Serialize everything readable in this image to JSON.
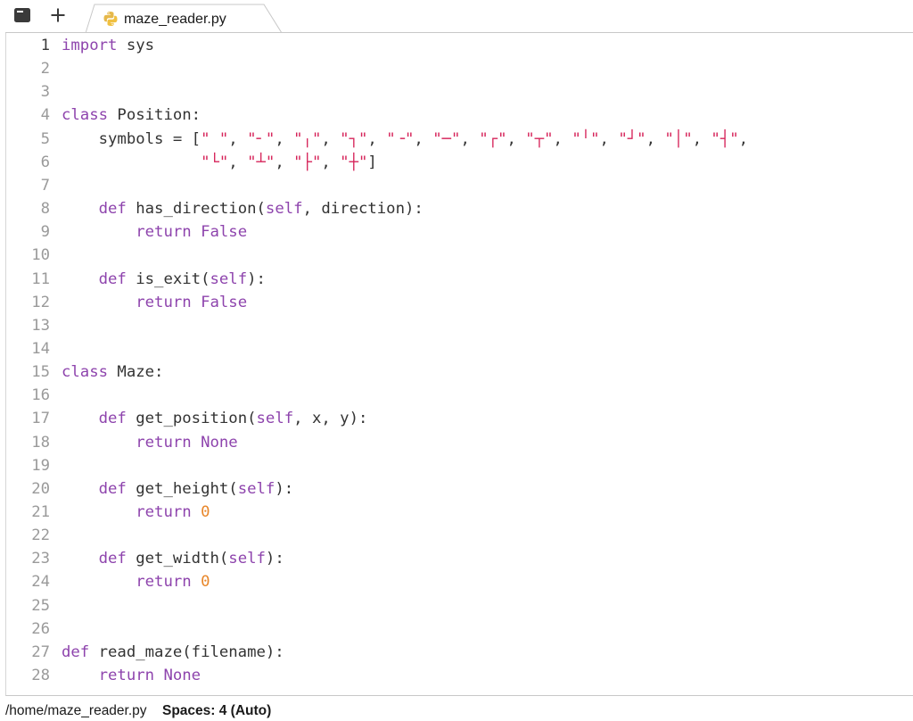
{
  "tabbar": {
    "menu_icon": "menu-square-icon",
    "add_icon": "plus-icon",
    "active_tab": {
      "label": "maze_reader.py",
      "icon": "python-icon"
    }
  },
  "editor": {
    "active_line": 1,
    "lines": [
      {
        "n": "1",
        "tokens": [
          [
            "kw",
            "import"
          ],
          [
            "p",
            " sys"
          ]
        ]
      },
      {
        "n": "2",
        "tokens": []
      },
      {
        "n": "3",
        "tokens": []
      },
      {
        "n": "4",
        "tokens": [
          [
            "kw",
            "class"
          ],
          [
            "p",
            " Position:"
          ]
        ]
      },
      {
        "n": "5",
        "tokens": [
          [
            "p",
            "    symbols = ["
          ],
          [
            "str",
            "\" \""
          ],
          [
            "p",
            ", "
          ],
          [
            "str",
            "\"╴\""
          ],
          [
            "p",
            ", "
          ],
          [
            "str",
            "\"╷\""
          ],
          [
            "p",
            ", "
          ],
          [
            "str",
            "\"┐\""
          ],
          [
            "p",
            ", "
          ],
          [
            "str",
            "\"╶\""
          ],
          [
            "p",
            ", "
          ],
          [
            "str",
            "\"─\""
          ],
          [
            "p",
            ", "
          ],
          [
            "str",
            "\"┌\""
          ],
          [
            "p",
            ", "
          ],
          [
            "str",
            "\"┬\""
          ],
          [
            "p",
            ", "
          ],
          [
            "str",
            "\"╵\""
          ],
          [
            "p",
            ", "
          ],
          [
            "str",
            "\"┘\""
          ],
          [
            "p",
            ", "
          ],
          [
            "str",
            "\"│\""
          ],
          [
            "p",
            ", "
          ],
          [
            "str",
            "\"┤\""
          ],
          [
            "p",
            ","
          ]
        ]
      },
      {
        "n": "6",
        "tokens": [
          [
            "p",
            "               "
          ],
          [
            "str",
            "\"└\""
          ],
          [
            "p",
            ", "
          ],
          [
            "str",
            "\"┴\""
          ],
          [
            "p",
            ", "
          ],
          [
            "str",
            "\"├\""
          ],
          [
            "p",
            ", "
          ],
          [
            "str",
            "\"┼\""
          ],
          [
            "p",
            "]"
          ]
        ]
      },
      {
        "n": "7",
        "tokens": []
      },
      {
        "n": "8",
        "tokens": [
          [
            "p",
            "    "
          ],
          [
            "kw",
            "def"
          ],
          [
            "p",
            " has_direction("
          ],
          [
            "self",
            "self"
          ],
          [
            "p",
            ", direction):"
          ]
        ]
      },
      {
        "n": "9",
        "tokens": [
          [
            "p",
            "        "
          ],
          [
            "kw",
            "return"
          ],
          [
            "p",
            " "
          ],
          [
            "kw2",
            "False"
          ]
        ]
      },
      {
        "n": "10",
        "tokens": []
      },
      {
        "n": "11",
        "tokens": [
          [
            "p",
            "    "
          ],
          [
            "kw",
            "def"
          ],
          [
            "p",
            " is_exit("
          ],
          [
            "self",
            "self"
          ],
          [
            "p",
            "):"
          ]
        ]
      },
      {
        "n": "12",
        "tokens": [
          [
            "p",
            "        "
          ],
          [
            "kw",
            "return"
          ],
          [
            "p",
            " "
          ],
          [
            "kw2",
            "False"
          ]
        ]
      },
      {
        "n": "13",
        "tokens": []
      },
      {
        "n": "14",
        "tokens": []
      },
      {
        "n": "15",
        "tokens": [
          [
            "kw",
            "class"
          ],
          [
            "p",
            " Maze:"
          ]
        ]
      },
      {
        "n": "16",
        "tokens": []
      },
      {
        "n": "17",
        "tokens": [
          [
            "p",
            "    "
          ],
          [
            "kw",
            "def"
          ],
          [
            "p",
            " get_position("
          ],
          [
            "self",
            "self"
          ],
          [
            "p",
            ", x, y):"
          ]
        ]
      },
      {
        "n": "18",
        "tokens": [
          [
            "p",
            "        "
          ],
          [
            "kw",
            "return"
          ],
          [
            "p",
            " "
          ],
          [
            "kw2",
            "None"
          ]
        ]
      },
      {
        "n": "19",
        "tokens": []
      },
      {
        "n": "20",
        "tokens": [
          [
            "p",
            "    "
          ],
          [
            "kw",
            "def"
          ],
          [
            "p",
            " get_height("
          ],
          [
            "self",
            "self"
          ],
          [
            "p",
            "):"
          ]
        ]
      },
      {
        "n": "21",
        "tokens": [
          [
            "p",
            "        "
          ],
          [
            "kw",
            "return"
          ],
          [
            "p",
            " "
          ],
          [
            "num",
            "0"
          ]
        ]
      },
      {
        "n": "22",
        "tokens": []
      },
      {
        "n": "23",
        "tokens": [
          [
            "p",
            "    "
          ],
          [
            "kw",
            "def"
          ],
          [
            "p",
            " get_width("
          ],
          [
            "self",
            "self"
          ],
          [
            "p",
            "):"
          ]
        ]
      },
      {
        "n": "24",
        "tokens": [
          [
            "p",
            "        "
          ],
          [
            "kw",
            "return"
          ],
          [
            "p",
            " "
          ],
          [
            "num",
            "0"
          ]
        ]
      },
      {
        "n": "25",
        "tokens": []
      },
      {
        "n": "26",
        "tokens": []
      },
      {
        "n": "27",
        "tokens": [
          [
            "kw",
            "def"
          ],
          [
            "p",
            " read_maze(filename):"
          ]
        ]
      },
      {
        "n": "28",
        "tokens": [
          [
            "p",
            "    "
          ],
          [
            "kw",
            "return"
          ],
          [
            "p",
            " "
          ],
          [
            "kw2",
            "None"
          ]
        ]
      }
    ]
  },
  "statusbar": {
    "path": "/home/maze_reader.py",
    "spaces": "Spaces: 4 (Auto)"
  },
  "colors": {
    "keyword": "#8e44ad",
    "string": "#d6245a",
    "number": "#e8862a",
    "text": "#333333",
    "line_number": "#9a9a9a"
  }
}
